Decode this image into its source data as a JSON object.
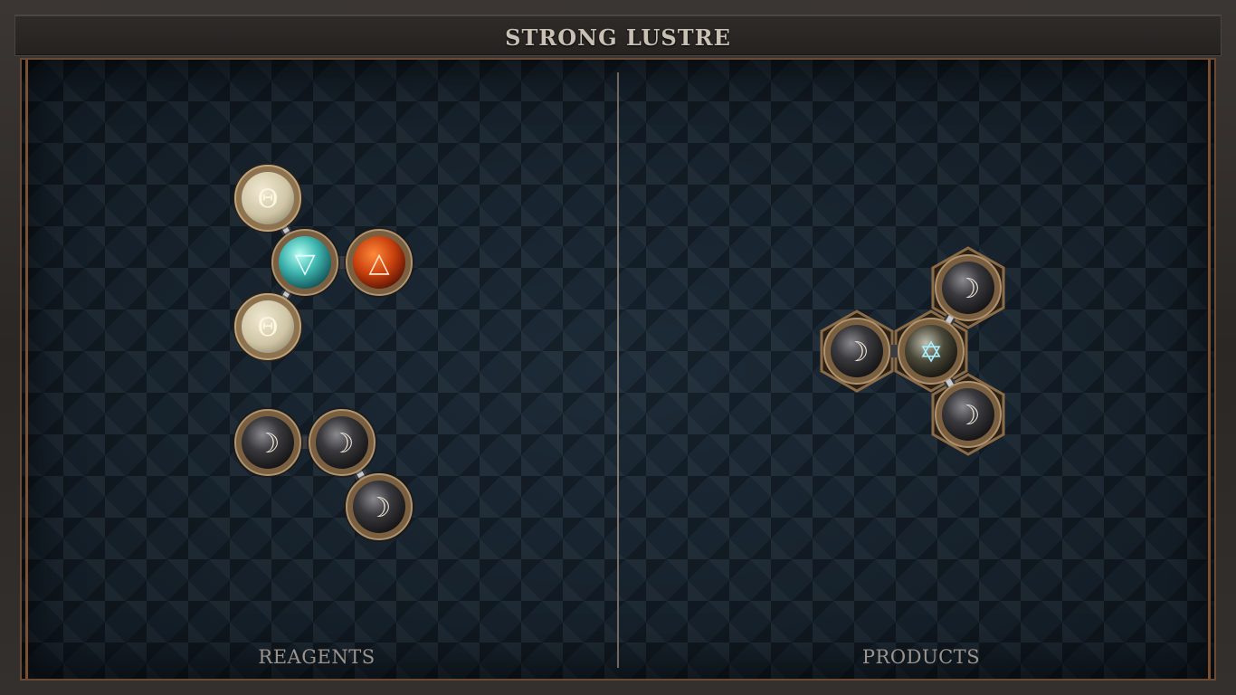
{
  "title": "STRONG LUSTRE",
  "panels": {
    "left_label": "REAGENTS",
    "right_label": "PRODUCTS"
  },
  "symbols": {
    "salt": "Θ",
    "water": "▽",
    "fire": "△",
    "silver": "☽",
    "quintessence": "✡"
  },
  "reagents": [
    {
      "name": "reagent-molecule-1",
      "atoms": [
        "salt",
        "water",
        "fire",
        "salt"
      ]
    },
    {
      "name": "reagent-molecule-2",
      "atoms": [
        "silver",
        "silver",
        "silver"
      ]
    }
  ],
  "products": [
    {
      "name": "product-molecule-1",
      "atoms": [
        "silver",
        "quintessence",
        "silver",
        "silver"
      ]
    }
  ],
  "colors": {
    "frame_accent": "#7a5030",
    "board_bg": "#15202a",
    "salt": "#d9d0b4",
    "water": "#3fb7b0",
    "fire": "#c8400e",
    "silver": "#2b2b2e",
    "bronze_ring": "#a6865e"
  }
}
